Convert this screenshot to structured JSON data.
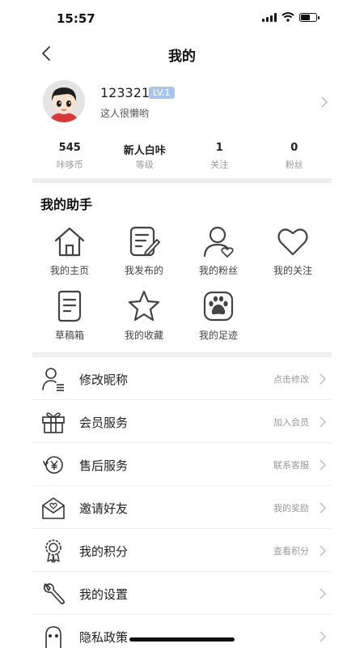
{
  "status_bar": {
    "time": "15:57"
  },
  "nav": {
    "title": "我的"
  },
  "profile": {
    "username": "123321",
    "level": "LV.1",
    "signature": "这人很懒哟"
  },
  "stats": [
    {
      "value": "545",
      "label": "咔哆币"
    },
    {
      "value": "新人白咔",
      "label": "等级"
    },
    {
      "value": "1",
      "label": "关注"
    },
    {
      "value": "0",
      "label": "粉丝"
    }
  ],
  "helper": {
    "title": "我的助手",
    "items": [
      {
        "label": "我的主页",
        "icon": "home-icon"
      },
      {
        "label": "我发布的",
        "icon": "edit-note-icon"
      },
      {
        "label": "我的粉丝",
        "icon": "fans-icon"
      },
      {
        "label": "我的关注",
        "icon": "heart-icon"
      },
      {
        "label": "草稿箱",
        "icon": "draft-icon"
      },
      {
        "label": "我的收藏",
        "icon": "star-icon"
      },
      {
        "label": "我的足迹",
        "icon": "paw-icon"
      }
    ]
  },
  "menu": [
    {
      "label": "修改昵称",
      "hint": "点击修改",
      "icon": "user-edit-icon"
    },
    {
      "label": "会员服务",
      "hint": "加入会员",
      "icon": "gift-icon"
    },
    {
      "label": "售后服务",
      "hint": "联系客服",
      "icon": "yen-service-icon"
    },
    {
      "label": "邀请好友",
      "hint": "我的奖励",
      "icon": "invite-mail-icon"
    },
    {
      "label": "我的积分",
      "hint": "查看积分",
      "icon": "medal-icon"
    },
    {
      "label": "我的设置",
      "hint": "",
      "icon": "wrench-icon"
    },
    {
      "label": "隐私政策",
      "hint": "",
      "icon": "privacy-ghost-icon"
    }
  ]
}
